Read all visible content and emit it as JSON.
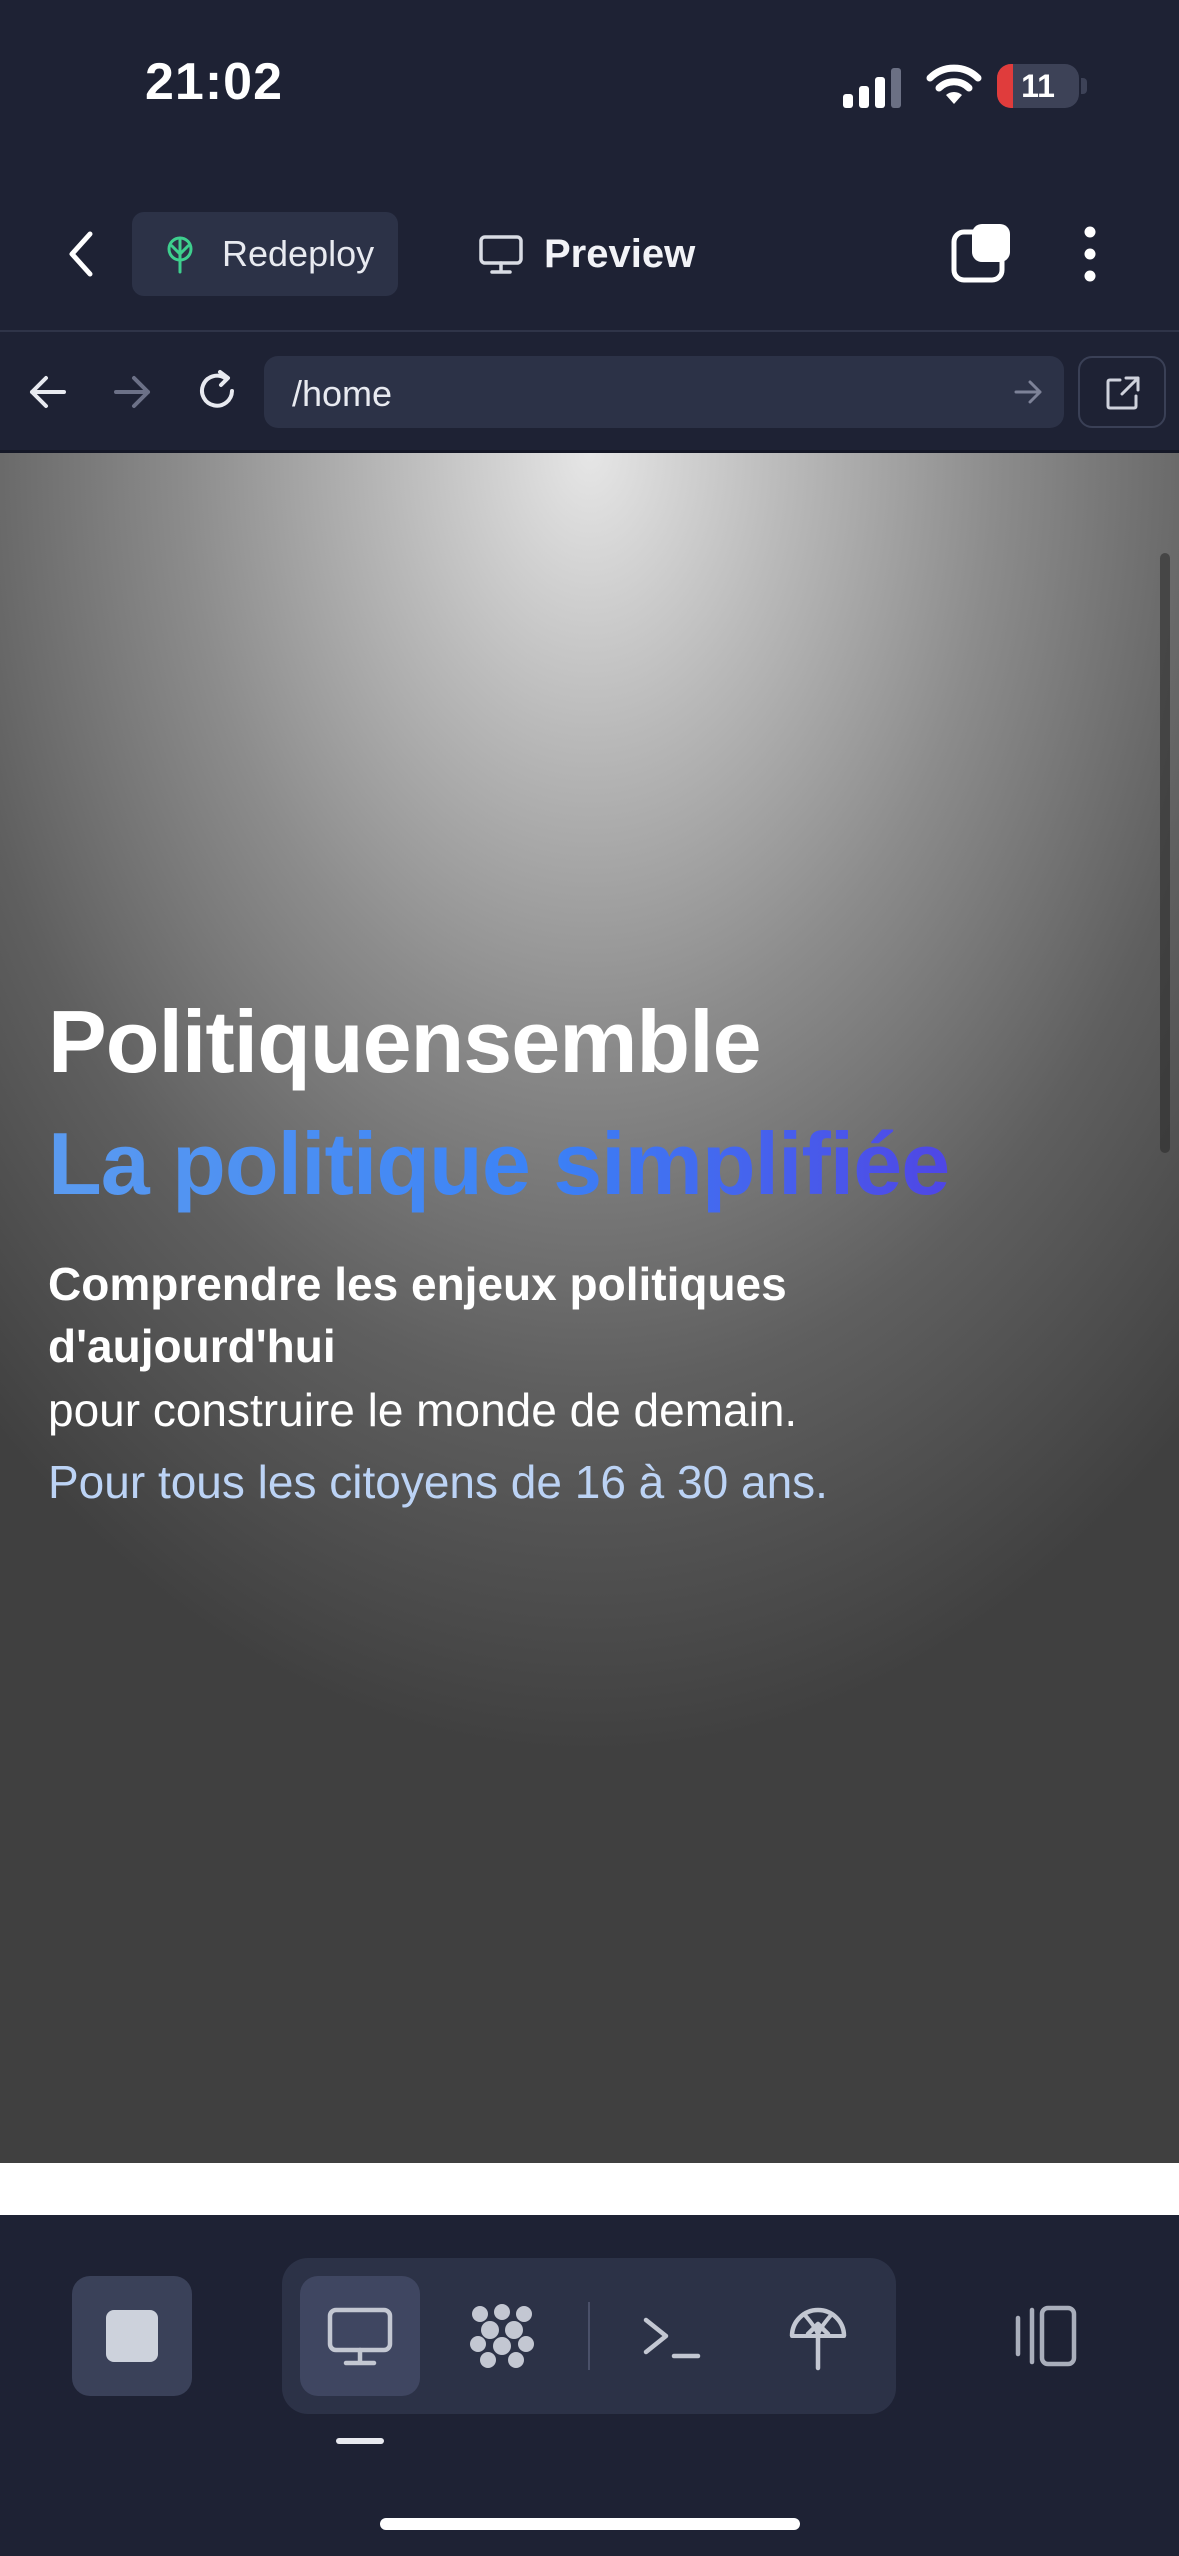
{
  "status_bar": {
    "time": "21:02",
    "battery": "11"
  },
  "toolbar": {
    "redeploy_label": "Redeploy",
    "preview_label": "Preview"
  },
  "browser": {
    "url": "/home"
  },
  "hero": {
    "title": "Politiquensemble",
    "subtitle": "La politique simplifiée",
    "line1": "Comprendre les enjeux politiques d'aujourd'hui",
    "line2": "pour construire le monde de demain.",
    "line3": "Pour tous les citoyens de 16 à 30 ans."
  },
  "colors": {
    "background": "#1e2234",
    "panel": "#2c3247",
    "accent_blue": "#3b82f6",
    "accent_indigo": "#4f46e5",
    "redeploy_icon": "#3ecf8e",
    "battery_low": "#e03c3c"
  },
  "icons": {
    "back": "chevron-left-icon",
    "redeploy": "deploy-tree-icon",
    "preview": "monitor-icon",
    "tabs": "tabs-icon",
    "more": "kebab-icon",
    "nav_back": "arrow-left-icon",
    "nav_forward": "arrow-right-icon",
    "reload": "reload-icon",
    "go": "arrow-right-icon",
    "external": "external-link-icon",
    "stop": "stop-icon",
    "packages": "packages-icon",
    "terminal": "terminal-icon",
    "deploy": "deploy-icon",
    "split": "split-view-icon"
  }
}
